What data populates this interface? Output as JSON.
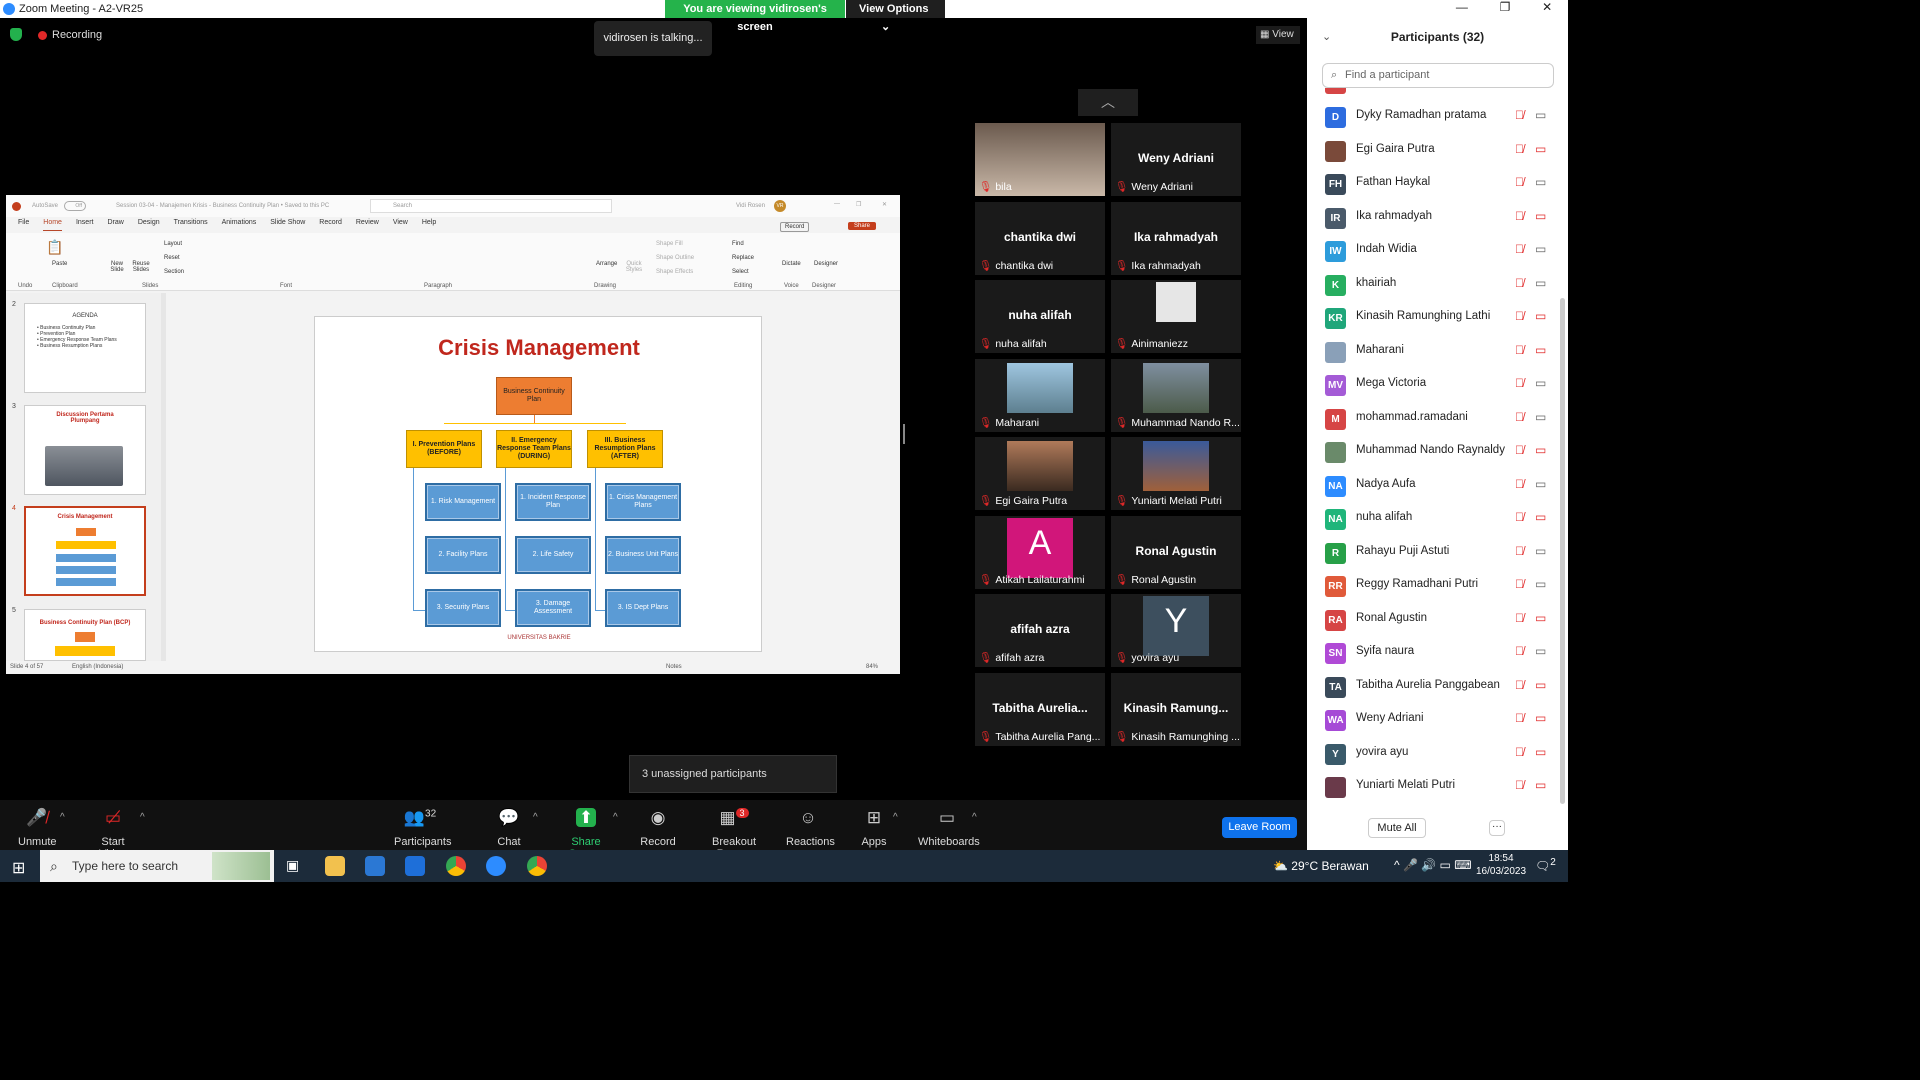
{
  "window": {
    "title": "Zoom Meeting - A2-VR25",
    "viewing_banner": "You are viewing vidirosen's screen",
    "view_options": "View Options"
  },
  "recording": {
    "label": "Recording"
  },
  "talking": "vidirosen is talking...",
  "view_button": "View",
  "ppt": {
    "autosave": "AutoSave",
    "autosave_state": "Off",
    "doc_title": "Session 03-04 - Manajemen Krisis - Business Continuity Plan • Saved to this PC",
    "search_placeholder": "Search",
    "user": "Vidi Rosen",
    "user_initials": "VR",
    "record_btn": "Record",
    "share_btn": "Share",
    "menu": [
      "File",
      "Home",
      "Insert",
      "Draw",
      "Design",
      "Transitions",
      "Animations",
      "Slide Show",
      "Record",
      "Review",
      "View",
      "Help"
    ],
    "ribbon_groups": [
      "Undo",
      "Clipboard",
      "Slides",
      "Font",
      "Paragraph",
      "Drawing",
      "Editing",
      "Voice",
      "Designer"
    ],
    "ribbon_buttons": {
      "paste": "Paste",
      "new_slide": "New Slide",
      "reuse": "Reuse Slides",
      "layout": "Layout",
      "reset": "Reset",
      "section": "Section",
      "arrange": "Arrange",
      "quick_styles": "Quick Styles",
      "shape_fill": "Shape Fill",
      "shape_outline": "Shape Outline",
      "shape_effects": "Shape Effects",
      "find": "Find",
      "replace": "Replace",
      "select": "Select",
      "dictate": "Dictate",
      "designer": "Designer"
    },
    "thumbs": [
      {
        "num": "2",
        "title": "AGENDA",
        "lines": [
          "• Business Continuity Plan",
          "• Prevention Plan",
          "• Emergency Response Team Plans",
          "• Business Resumption Plans"
        ]
      },
      {
        "num": "3",
        "title": "Discussion Pertama Plumpang"
      },
      {
        "num": "4",
        "title": "Crisis Management"
      },
      {
        "num": "5",
        "title": "Business Continuity Plan (BCP)"
      }
    ],
    "slide": {
      "title": "Crisis Management",
      "root": "Business Continuity Plan",
      "branches": [
        "I. Prevention Plans (BEFORE)",
        "II. Emergency Response Team Plans (DURING)",
        "III. Business Resumption Plans (AFTER)"
      ],
      "col1": [
        "1. Risk Management",
        "2. Facility Plans",
        "3. Security Plans"
      ],
      "col2": [
        "1. Incident Response Plan",
        "2. Life Safety",
        "3. Damage Assessment"
      ],
      "col3": [
        "1. Crisis Management Plans",
        "2. Business Unit Plans",
        "3. IS Dept Plans"
      ],
      "footer": "UNIVERSITAS BAKRIE"
    },
    "status": {
      "slide": "Slide 4 of 57",
      "lang": "English (Indonesia)",
      "notes": "Notes",
      "zoom": "84%"
    }
  },
  "gallery": [
    {
      "label": "bila",
      "type": "photo"
    },
    {
      "label": "Weny Adriani",
      "name": "Weny Adriani"
    },
    {
      "label": "chantika dwi",
      "name": "chantika dwi"
    },
    {
      "label": "Ika rahmadyah",
      "name": "Ika rahmadyah"
    },
    {
      "label": "nuha alifah",
      "name": "nuha alifah"
    },
    {
      "label": "Ainimaniezz",
      "type": "avatar"
    },
    {
      "label": "Maharani",
      "type": "photo"
    },
    {
      "label": "Muhammad Nando R...",
      "type": "photo"
    },
    {
      "label": "Egi Gaira Putra",
      "type": "photo"
    },
    {
      "label": "Yuniarti Melati Putri",
      "type": "photo"
    },
    {
      "label": "Atikah Lailaturahmi",
      "letter": "A"
    },
    {
      "label": "Ronal Agustin",
      "name": "Ronal Agustin"
    },
    {
      "label": "afifah azra",
      "name": "afifah azra"
    },
    {
      "label": "yovira ayu",
      "letter": "Y"
    },
    {
      "label": "Tabitha Aurelia Pang...",
      "name": "Tabitha Aurelia..."
    },
    {
      "label": "Kinasih Ramunghing ...",
      "name": "Kinasih Ramung..."
    }
  ],
  "unassigned": "3 unassigned participants",
  "toolbar": {
    "unmute": "Unmute",
    "start_video": "Start Video",
    "participants": "Participants",
    "participants_count": "32",
    "chat": "Chat",
    "share": "Share Screen",
    "record": "Record",
    "breakout": "Breakout Rooms",
    "breakout_badge": "3",
    "reactions": "Reactions",
    "apps": "Apps",
    "whiteboards": "Whiteboards",
    "leave": "Leave Room"
  },
  "participants_panel": {
    "title": "Participants (32)",
    "search_placeholder": "Find a participant",
    "list": [
      {
        "initials": "D",
        "name": "Dyky Ramadhan pratama",
        "color": "#2d6cdf",
        "cam": "on"
      },
      {
        "initials": "",
        "name": "Egi Gaira Putra",
        "color": "#7a4a3a",
        "cam": "off"
      },
      {
        "initials": "FH",
        "name": "Fathan Haykal",
        "color": "#3a4a5a",
        "cam": "on"
      },
      {
        "initials": "IR",
        "name": "Ika rahmadyah",
        "color": "#4a5a6a",
        "cam": "off"
      },
      {
        "initials": "IW",
        "name": "Indah Widia",
        "color": "#2d9cdb",
        "cam": "on"
      },
      {
        "initials": "K",
        "name": "khairiah",
        "color": "#27ae60",
        "cam": "on"
      },
      {
        "initials": "KR",
        "name": "Kinasih Ramunghing Lathi",
        "color": "#1fa67a",
        "cam": "off"
      },
      {
        "initials": "",
        "name": "Maharani",
        "color": "#8aa0b8",
        "cam": "off"
      },
      {
        "initials": "MV",
        "name": "Mega Victoria",
        "color": "#a45bd6",
        "cam": "on"
      },
      {
        "initials": "M",
        "name": "mohammad.ramadani",
        "color": "#d64545",
        "cam": "on"
      },
      {
        "initials": "",
        "name": "Muhammad Nando Raynaldy",
        "color": "#6a8a6a",
        "cam": "off"
      },
      {
        "initials": "NA",
        "name": "Nadya Aufa",
        "color": "#2d8cff",
        "cam": "on"
      },
      {
        "initials": "NA",
        "name": "nuha alifah",
        "color": "#1fb57a",
        "cam": "off"
      },
      {
        "initials": "R",
        "name": "Rahayu Puji Astuti",
        "color": "#27a048",
        "cam": "on"
      },
      {
        "initials": "RR",
        "name": "Reggy Ramadhani Putri",
        "color": "#e05a3a",
        "cam": "on"
      },
      {
        "initials": "RA",
        "name": "Ronal Agustin",
        "color": "#d64545",
        "cam": "off"
      },
      {
        "initials": "SN",
        "name": "Syifa naura",
        "color": "#b04ad6",
        "cam": "on"
      },
      {
        "initials": "TA",
        "name": "Tabitha Aurelia Panggabean",
        "color": "#3a4a5a",
        "cam": "off"
      },
      {
        "initials": "WA",
        "name": "Weny Adriani",
        "color": "#a64ad6",
        "cam": "off"
      },
      {
        "initials": "Y",
        "name": "yovira ayu",
        "color": "#3a5a6a",
        "cam": "off"
      },
      {
        "initials": "",
        "name": "Yuniarti Melati Putri",
        "color": "#6a3a4a",
        "cam": "off"
      }
    ],
    "mute_all": "Mute All",
    "more": "···"
  },
  "taskbar": {
    "search_placeholder": "Type here to search",
    "weather": "29°C Berawan",
    "time": "18:54",
    "date": "16/03/2023",
    "notif": "2"
  }
}
